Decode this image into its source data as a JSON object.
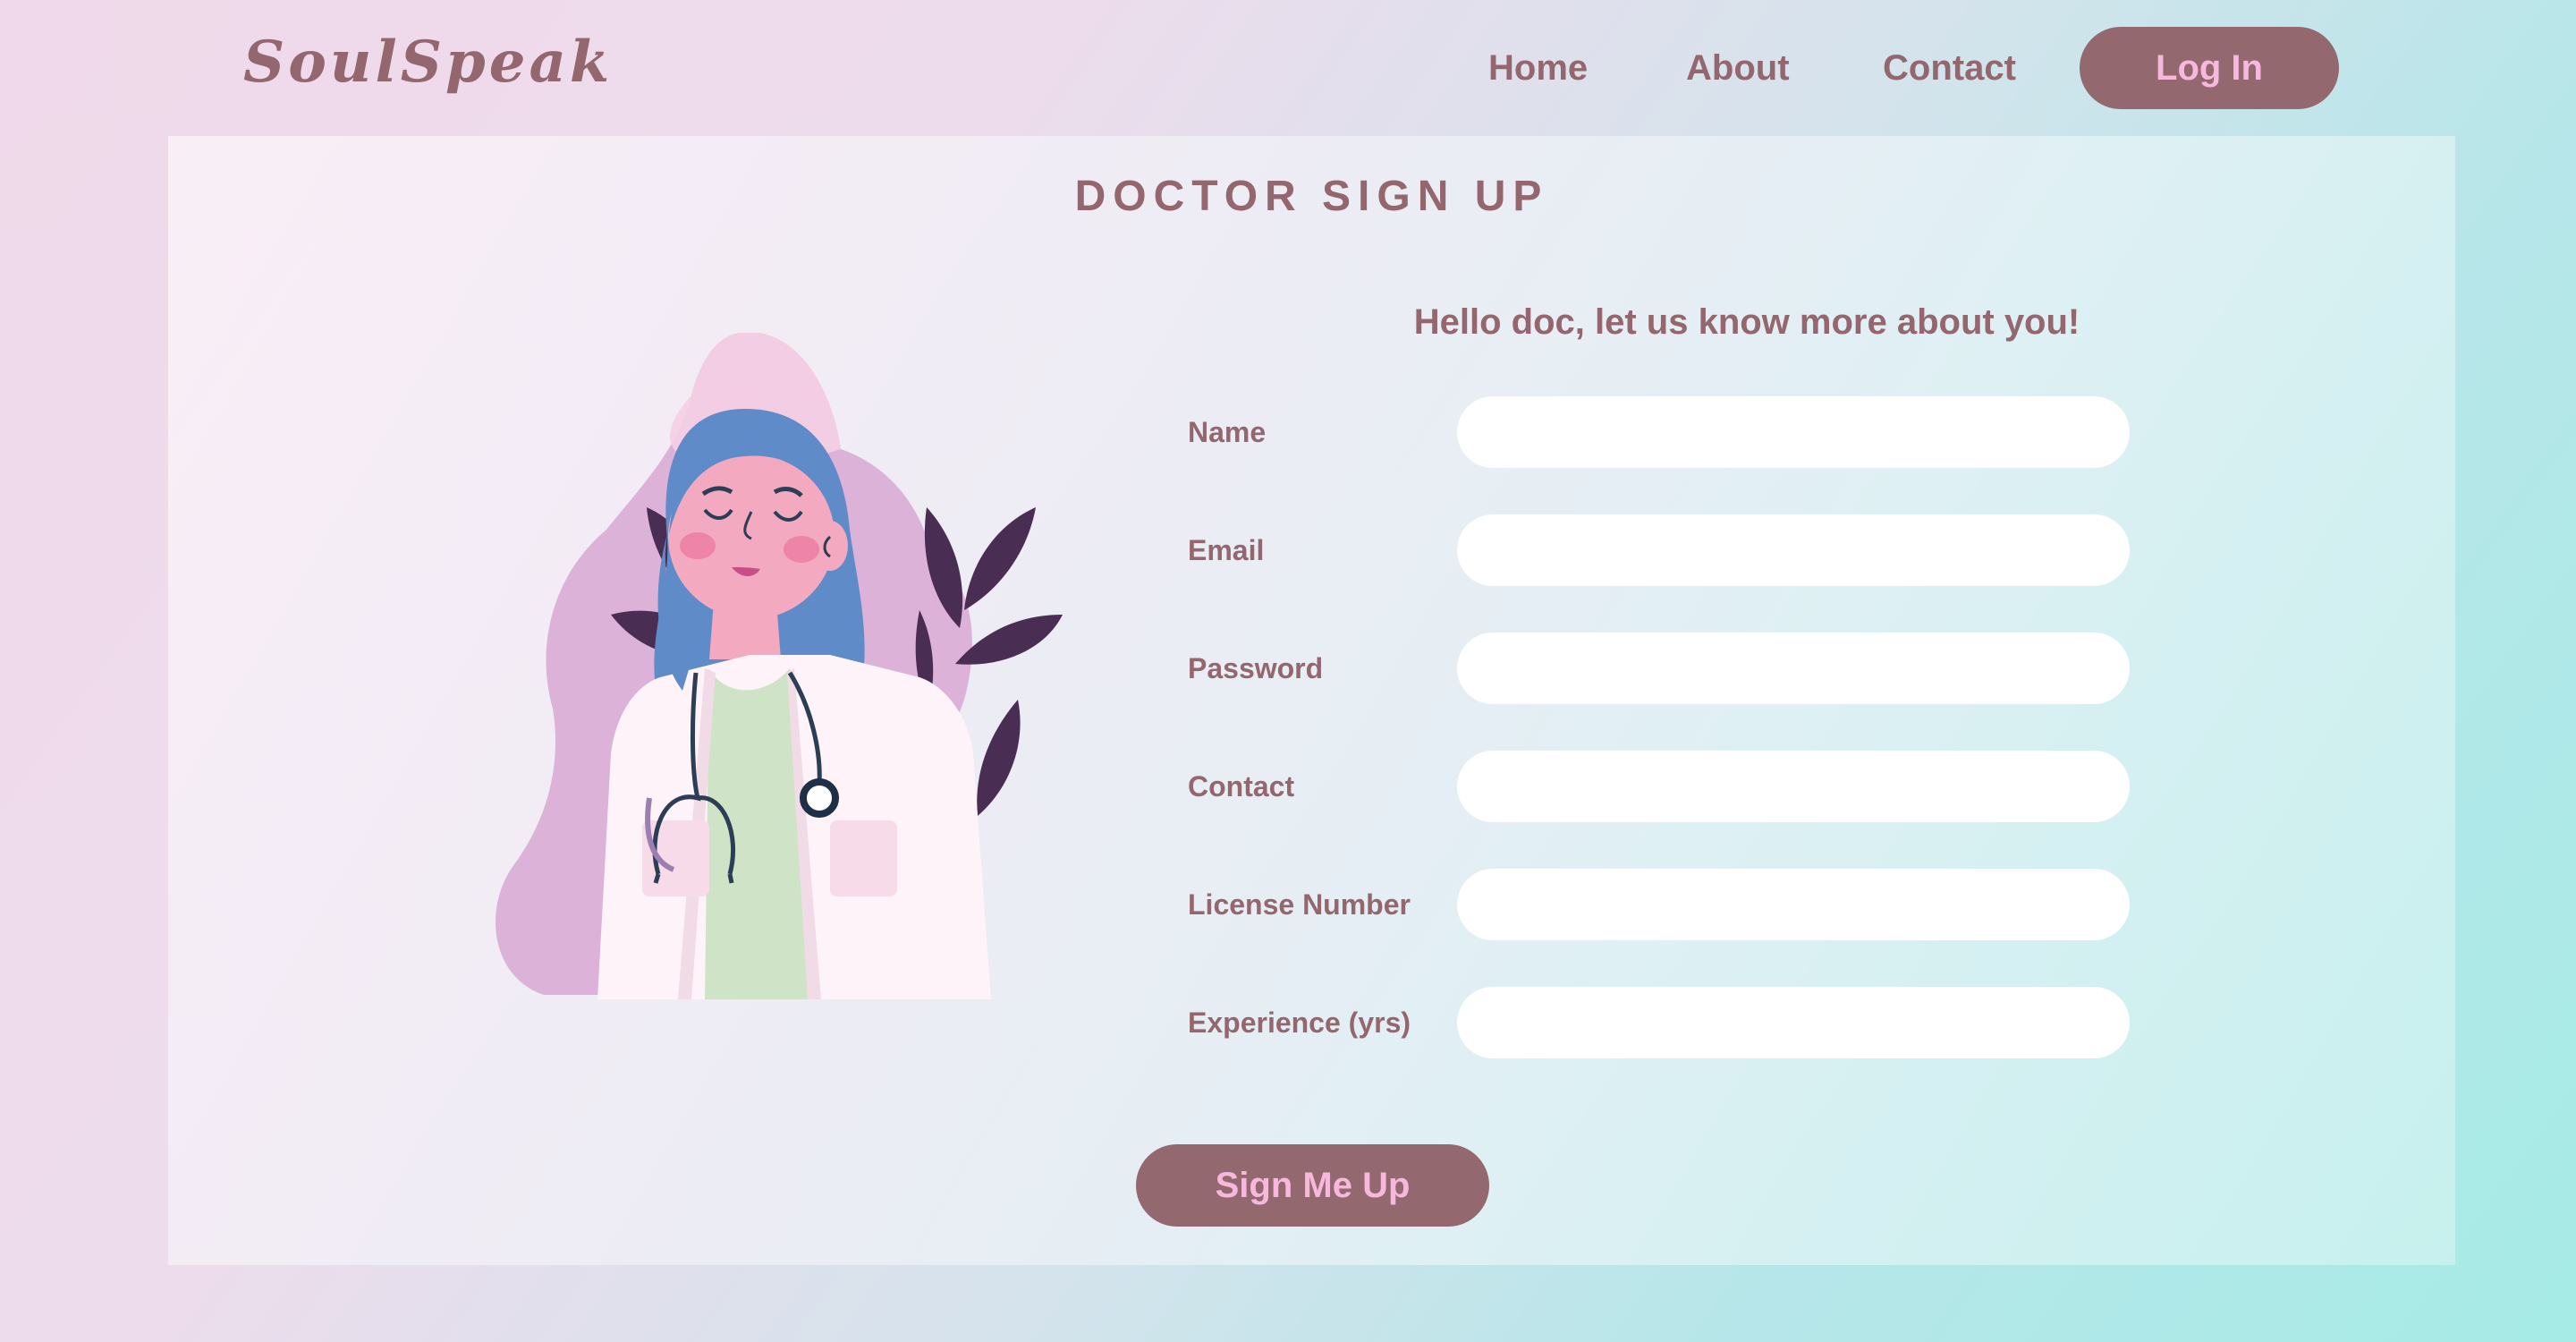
{
  "brand": {
    "logo_text": "SoulSpeak"
  },
  "nav": {
    "links": [
      {
        "label": "Home"
      },
      {
        "label": "About"
      },
      {
        "label": "Contact"
      }
    ],
    "login_label": "Log In"
  },
  "page": {
    "title": "DOCTOR SIGN UP",
    "subtitle": "Hello doc, let us know more about you!"
  },
  "form": {
    "fields": [
      {
        "label": "Name",
        "value": "",
        "placeholder": ""
      },
      {
        "label": "Email",
        "value": "",
        "placeholder": ""
      },
      {
        "label": "Password",
        "value": "",
        "placeholder": ""
      },
      {
        "label": "Contact",
        "value": "",
        "placeholder": ""
      },
      {
        "label": "License Number",
        "value": "",
        "placeholder": ""
      },
      {
        "label": "Experience (yrs)",
        "value": "",
        "placeholder": ""
      }
    ],
    "submit_label": "Sign Me Up"
  },
  "illustration": {
    "icon": "doctor-illustration"
  },
  "colors": {
    "accent": "#94686f",
    "button_text": "#f6b8dc",
    "input_bg": "#ffffff"
  }
}
